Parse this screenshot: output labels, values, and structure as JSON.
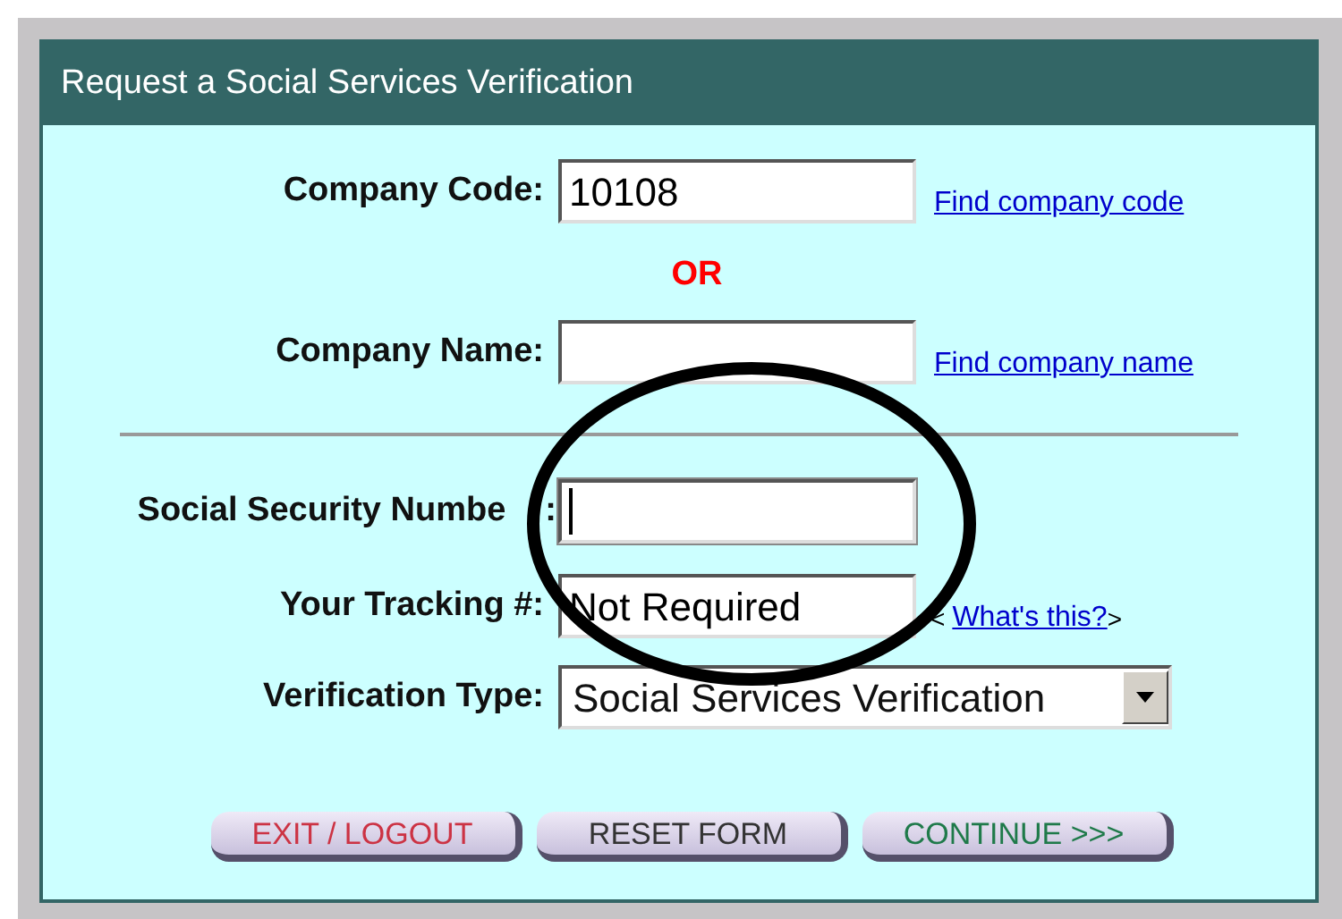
{
  "header": {
    "title": "Request a Social Services Verification"
  },
  "company_code": {
    "label": "Company Code:",
    "value": "10108",
    "link": "Find company code"
  },
  "separator": "OR",
  "company_name": {
    "label": "Company Name:",
    "link": "Find company name"
  },
  "ssn": {
    "label": "Social Security Numbe",
    "label_end": ":",
    "focused": true
  },
  "tracking": {
    "label": "Your Tracking #:",
    "value": "Not Required",
    "link_prefix": "<",
    "link": "What's this?",
    "link_suffix": ">"
  },
  "verification_type": {
    "label": "Verification Type:",
    "value": "Social Services Verification"
  },
  "buttons": [
    {
      "label": "EXIT / LOGOUT",
      "kind": "exit"
    },
    {
      "label": "RESET FORM",
      "kind": "reset"
    },
    {
      "label": "CONTINUE >>>",
      "kind": "continue"
    }
  ]
}
